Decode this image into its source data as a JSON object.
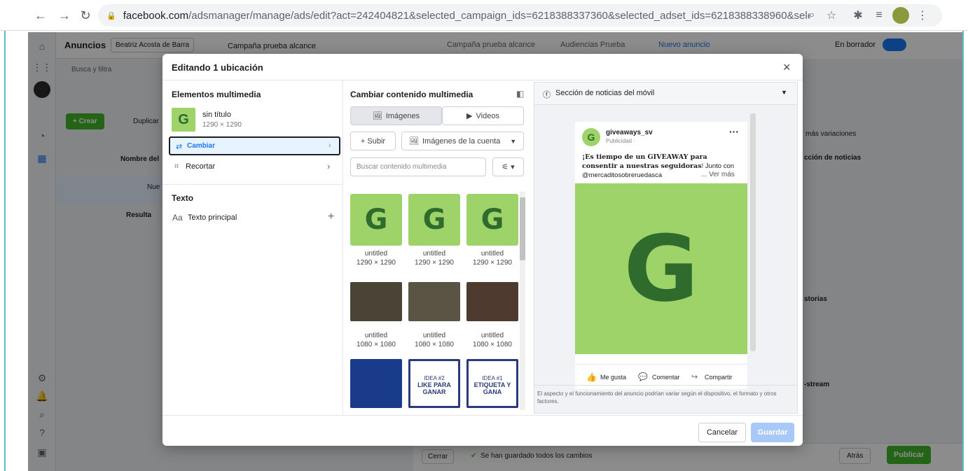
{
  "browser": {
    "url_host": "facebook.com",
    "url_path": "/adsmanager/manage/ads/edit?act=242404821&selected_campaign_ids=6218388337360&selected_adset_ids=6218388338960&selected_ad_ids=6..."
  },
  "app": {
    "title": "Anuncios",
    "account": "Beatriz Acosta de Barra",
    "search_placeholder": "Busca y filtra",
    "create": "+ Crear",
    "duplicate": "Duplicar",
    "col_name": "Nombre del",
    "row_label": "Nue",
    "results": "Resulta",
    "close_btn": "Cerrar",
    "saved_status": "Se han guardado todos los cambios",
    "back_btn": "Atrás",
    "publish_btn": "Publicar",
    "draft_label": "En borrador",
    "campaign_tab": "Campaña prueba alcance"
  },
  "breadcrumb": {
    "campaign": "Campaña prueba alcance",
    "adset": "Audiencias Prueba",
    "ad": "Nuevo anuncio"
  },
  "right_panel": {
    "variations": "más variaciones",
    "feed_section": "cción de noticias",
    "stories": "storias",
    "instream": "-stream"
  },
  "modal": {
    "title": "Editando 1 ubicación",
    "media_heading": "Elementos multimedia",
    "media_name": "sin título",
    "media_dims": "1290 × 1290",
    "change": "Cambiar",
    "crop": "Recortar",
    "text_heading": "Texto",
    "primary_text": "Texto principal",
    "change_media_heading": "Cambiar contenido multimedia",
    "tab_images": "Imágenes",
    "tab_videos": "Videos",
    "upload": "+ Subir",
    "account_images": "Imágenes de la cuenta",
    "search_placeholder": "Buscar contenido multimedia",
    "grid": [
      {
        "name": "untitled",
        "dims": "1290 × 1290"
      },
      {
        "name": "untitled",
        "dims": "1290 × 1290"
      },
      {
        "name": "untitled",
        "dims": "1290 × 1290"
      },
      {
        "name": "untitled",
        "dims": "1080 × 1080"
      },
      {
        "name": "untitled",
        "dims": "1080 × 1080"
      },
      {
        "name": "untitled",
        "dims": "1080 × 1080"
      }
    ],
    "idea2_top": "IDEA #2",
    "idea2_bottom": "LIKE PARA GANAR",
    "idea1_top": "IDEA #1",
    "idea1_bottom": "ETIQUETA Y GANA",
    "placement": "Sección de noticias del móvil",
    "post_page": "giveaways_sv",
    "post_sub": "Publicidad · ",
    "post_text_bold": "¡Es tiempo de un GIVEAWAY para consentir a nuestras seguidoras",
    "post_text_rest": "! Junto con",
    "post_mention": "@mercaditosobreruedasca",
    "see_more": "... Ver más",
    "like": "Me gusta",
    "comment": "Comentar",
    "share": "Compartir",
    "disclaimer": "El aspecto y el funcionamiento del anuncio podrían variar según el dispositivo, el formato y otros factores.",
    "cancel": "Cancelar",
    "save": "Guardar",
    "thumb_letter": "G"
  },
  "colors": {
    "accent": "#1877f2",
    "green": "#42b72a",
    "tile": "#9ed36a",
    "logo_green": "#2e6b2c"
  }
}
